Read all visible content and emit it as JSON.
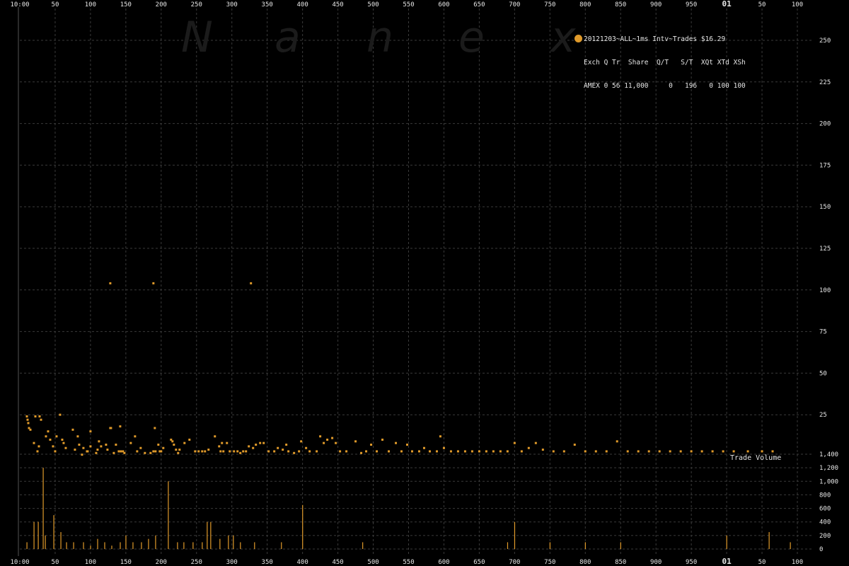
{
  "watermark": {
    "letters": [
      "N",
      "a",
      "n",
      "e",
      "x"
    ]
  },
  "legend": {
    "title": "20121203~ALL~1ms Intv~Trades $16.29",
    "header": "Exch Q Tr  Share  Q/T   S/T  XQt XTd XSh",
    "row": "AMEX 0 56 11,000     0   196   0 100 100",
    "dot_color": "#e09a2a"
  },
  "volume_label": "Trade Volume",
  "colors": {
    "series": "#e09a2a",
    "grid": "#3a3a3a",
    "axis_text": "#e6e6e6",
    "background": "#000000"
  },
  "chart_data": {
    "type": "scatter",
    "title": "",
    "xlabel": "",
    "x_tick_labels_top": [
      "10:00",
      "50",
      "100",
      "150",
      "200",
      "250",
      "300",
      "350",
      "400",
      "450",
      "500",
      "550",
      "600",
      "650",
      "700",
      "750",
      "800",
      "850",
      "900",
      "950",
      "01",
      "50",
      "100"
    ],
    "x_tick_labels_bottom": [
      "10:00",
      "50",
      "100",
      "150",
      "200",
      "250",
      "300",
      "350",
      "400",
      "450",
      "500",
      "550",
      "600",
      "650",
      "700",
      "750",
      "800",
      "850",
      "900",
      "950",
      "01",
      "50",
      "100"
    ],
    "xlim": [
      0,
      1100
    ],
    "grid": true,
    "top_panel": {
      "ylabel": "",
      "ylim": [
        0,
        250
      ],
      "y_ticks": [
        25,
        50,
        75,
        100,
        125,
        150,
        175,
        200,
        225,
        250
      ],
      "series": [
        {
          "points": [
            [
              10,
              24
            ],
            [
              11,
              22
            ],
            [
              12,
              20
            ],
            [
              13,
              17
            ],
            [
              15,
              16
            ],
            [
              20,
              8
            ],
            [
              22,
              24
            ],
            [
              25,
              3
            ],
            [
              27,
              6
            ],
            [
              28,
              24
            ],
            [
              30,
              22
            ],
            [
              37,
              12
            ],
            [
              40,
              15
            ],
            [
              43,
              10
            ],
            [
              47,
              6
            ],
            [
              50,
              3
            ],
            [
              52,
              12
            ],
            [
              57,
              25
            ],
            [
              60,
              10
            ],
            [
              62,
              8
            ],
            [
              65,
              5
            ],
            [
              75,
              16
            ],
            [
              78,
              4
            ],
            [
              82,
              12
            ],
            [
              84,
              7
            ],
            [
              88,
              1
            ],
            [
              90,
              5
            ],
            [
              95,
              3
            ],
            [
              96,
              3
            ],
            [
              100,
              6
            ],
            [
              100,
              15
            ],
            [
              108,
              2
            ],
            [
              110,
              4
            ],
            [
              112,
              9
            ],
            [
              115,
              6
            ],
            [
              122,
              7
            ],
            [
              124,
              4
            ],
            [
              128,
              17
            ],
            [
              128,
              104
            ],
            [
              129,
              17
            ],
            [
              133,
              2
            ],
            [
              136,
              7
            ],
            [
              140,
              3
            ],
            [
              142,
              18
            ],
            [
              143,
              3
            ],
            [
              146,
              3
            ],
            [
              148,
              2
            ],
            [
              157,
              8
            ],
            [
              163,
              12
            ],
            [
              166,
              3
            ],
            [
              171,
              5
            ],
            [
              177,
              2
            ],
            [
              185,
              2
            ],
            [
              189,
              3
            ],
            [
              189,
              104
            ],
            [
              191,
              17
            ],
            [
              192,
              3
            ],
            [
              196,
              7
            ],
            [
              198,
              3
            ],
            [
              200,
              3
            ],
            [
              203,
              5
            ],
            [
              214,
              10
            ],
            [
              216,
              9
            ],
            [
              218,
              7
            ],
            [
              221,
              4
            ],
            [
              224,
              2
            ],
            [
              226,
              4
            ],
            [
              233,
              8
            ],
            [
              240,
              10
            ],
            [
              248,
              3
            ],
            [
              253,
              3
            ],
            [
              258,
              3
            ],
            [
              262,
              3
            ],
            [
              267,
              4
            ],
            [
              276,
              12
            ],
            [
              282,
              6
            ],
            [
              284,
              3
            ],
            [
              286,
              8
            ],
            [
              288,
              3
            ],
            [
              293,
              8
            ],
            [
              297,
              3
            ],
            [
              303,
              3
            ],
            [
              308,
              3
            ],
            [
              312,
              2
            ],
            [
              316,
              3
            ],
            [
              320,
              3
            ],
            [
              324,
              6
            ],
            [
              327,
              104
            ],
            [
              330,
              5
            ],
            [
              334,
              7
            ],
            [
              340,
              8
            ],
            [
              345,
              8
            ],
            [
              352,
              3
            ],
            [
              360,
              3
            ],
            [
              365,
              5
            ],
            [
              372,
              4
            ],
            [
              377,
              7
            ],
            [
              380,
              3
            ],
            [
              388,
              2
            ],
            [
              395,
              3
            ],
            [
              398,
              9
            ],
            [
              405,
              5
            ],
            [
              410,
              3
            ],
            [
              420,
              3
            ],
            [
              425,
              12
            ],
            [
              430,
              8
            ],
            [
              435,
              10
            ],
            [
              442,
              11
            ],
            [
              447,
              8
            ],
            [
              453,
              3
            ],
            [
              462,
              3
            ],
            [
              475,
              9
            ],
            [
              483,
              2
            ],
            [
              490,
              3
            ],
            [
              497,
              7
            ],
            [
              505,
              3
            ],
            [
              513,
              10
            ],
            [
              522,
              3
            ],
            [
              532,
              8
            ],
            [
              540,
              3
            ],
            [
              548,
              7
            ],
            [
              555,
              3
            ],
            [
              565,
              3
            ],
            [
              572,
              5
            ],
            [
              580,
              3
            ],
            [
              590,
              3
            ],
            [
              595,
              12
            ],
            [
              600,
              5
            ],
            [
              610,
              3
            ],
            [
              620,
              3
            ],
            [
              630,
              3
            ],
            [
              640,
              3
            ],
            [
              650,
              3
            ],
            [
              660,
              3
            ],
            [
              670,
              3
            ],
            [
              680,
              3
            ],
            [
              690,
              3
            ],
            [
              700,
              8
            ],
            [
              710,
              3
            ],
            [
              720,
              5
            ],
            [
              730,
              8
            ],
            [
              740,
              4
            ],
            [
              755,
              3
            ],
            [
              770,
              3
            ],
            [
              785,
              7
            ],
            [
              800,
              3
            ],
            [
              815,
              3
            ],
            [
              830,
              3
            ],
            [
              845,
              9
            ],
            [
              860,
              3
            ],
            [
              875,
              3
            ],
            [
              890,
              3
            ],
            [
              905,
              3
            ],
            [
              920,
              3
            ],
            [
              935,
              3
            ],
            [
              950,
              3
            ],
            [
              965,
              3
            ],
            [
              980,
              3
            ],
            [
              995,
              3
            ],
            [
              1010,
              3
            ],
            [
              1030,
              3
            ],
            [
              1050,
              3
            ],
            [
              1065,
              3
            ]
          ]
        }
      ]
    },
    "bottom_panel": {
      "ylabel": "",
      "ylim": [
        0,
        1400
      ],
      "y_tick_labels": [
        "0",
        "200",
        "400",
        "600",
        "800",
        "1,000",
        "1,200",
        "1,400"
      ],
      "y_ticks": [
        0,
        200,
        400,
        600,
        800,
        1000,
        1200,
        1400
      ],
      "series": [
        {
          "bars": [
            [
              10,
              100
            ],
            [
              20,
              400
            ],
            [
              26,
              400
            ],
            [
              33,
              1200
            ],
            [
              36,
              200
            ],
            [
              48,
              500
            ],
            [
              58,
              250
            ],
            [
              66,
              100
            ],
            [
              76,
              100
            ],
            [
              90,
              100
            ],
            [
              100,
              50
            ],
            [
              110,
              150
            ],
            [
              120,
              100
            ],
            [
              130,
              50
            ],
            [
              142,
              100
            ],
            [
              150,
              200
            ],
            [
              160,
              100
            ],
            [
              172,
              100
            ],
            [
              182,
              150
            ],
            [
              192,
              200
            ],
            [
              210,
              1000
            ],
            [
              223,
              100
            ],
            [
              232,
              100
            ],
            [
              245,
              100
            ],
            [
              258,
              100
            ],
            [
              265,
              400
            ],
            [
              270,
              400
            ],
            [
              283,
              150
            ],
            [
              295,
              200
            ],
            [
              302,
              200
            ],
            [
              312,
              100
            ],
            [
              332,
              100
            ],
            [
              370,
              100
            ],
            [
              400,
              650
            ],
            [
              485,
              100
            ],
            [
              690,
              100
            ],
            [
              700,
              400
            ],
            [
              750,
              100
            ],
            [
              800,
              100
            ],
            [
              850,
              100
            ],
            [
              1000,
              200
            ],
            [
              1060,
              250
            ],
            [
              1090,
              100
            ]
          ]
        }
      ]
    }
  }
}
